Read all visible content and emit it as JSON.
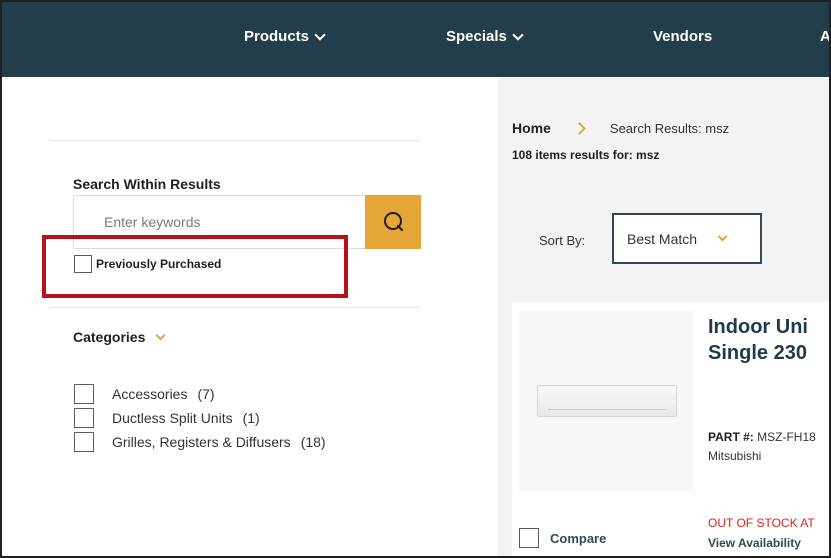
{
  "nav": {
    "items": [
      {
        "label": "Products",
        "has_dropdown": true
      },
      {
        "label": "Specials",
        "has_dropdown": true
      },
      {
        "label": "Vendors",
        "has_dropdown": false
      },
      {
        "label": "A",
        "has_dropdown": false
      }
    ]
  },
  "sidebar": {
    "search_title": "Search Within Results",
    "search_placeholder": "Enter keywords",
    "previously_purchased_label": "Previously Purchased",
    "categories_title": "Categories",
    "categories": [
      {
        "label": "Accessories",
        "count": "(7)"
      },
      {
        "label": "Ductless Split Units",
        "count": "(1)"
      },
      {
        "label": "Grilles, Registers & Diffusers",
        "count": "(18)"
      }
    ]
  },
  "breadcrumb": {
    "home": "Home",
    "current": "Search Results: msz"
  },
  "results_text": "108 items results for: msz",
  "sort": {
    "label": "Sort By:",
    "selected": "Best Match"
  },
  "product": {
    "name_line1": "Indoor Uni",
    "name_line2": "Single 230",
    "part_label": "PART #:",
    "part_value": "MSZ-FH18",
    "vendor": "Mitsubishi",
    "stock_status": "OUT OF STOCK AT",
    "availability_link": "View Availability",
    "compare_label": "Compare"
  },
  "colors": {
    "nav_bg": "#233d4a",
    "accent": "#e5a637",
    "highlight": "#b5121b",
    "out_of_stock": "#d0271d"
  },
  "icons": {
    "search_button": "search-icon",
    "dropdown": "chevron-down-icon",
    "breadcrumb_sep": "chevron-right-icon"
  }
}
